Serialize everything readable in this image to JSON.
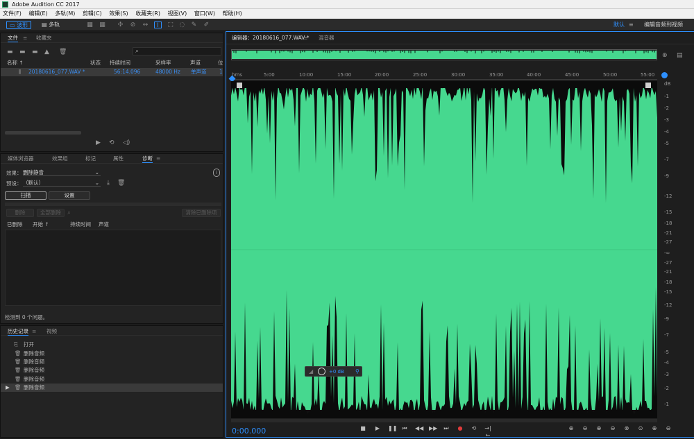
{
  "app": {
    "title": "Adobe Audition CC 2017"
  },
  "menu": [
    "文件(F)",
    "编辑(E)",
    "多轨(M)",
    "剪辑(C)",
    "效果(S)",
    "收藏夹(R)",
    "视图(V)",
    "窗口(W)",
    "帮助(H)"
  ],
  "toolbar": {
    "waveform": "波形",
    "multitrack": "多轨",
    "workspace": "默认",
    "workspace2": "编辑音频到视频"
  },
  "files_panel": {
    "tabs": [
      "文件",
      "收藏夹"
    ],
    "columns": [
      "名称 ↑",
      "状态",
      "持续时间",
      "采样率",
      "声道",
      "位"
    ],
    "file": {
      "name": "20180616_077.WAV *",
      "duration": "56:14.096",
      "rate": "48000 Hz",
      "channels": "单声道",
      "bit": "1"
    }
  },
  "diag_panel": {
    "tabs": [
      "媒体浏览器",
      "效果组",
      "标记",
      "属性",
      "诊断"
    ],
    "effect_label": "效果：",
    "effect_value": "删除静音",
    "preset_label": "预设：",
    "preset_value": "（默认）",
    "scan": "扫描",
    "settings": "设置",
    "delete": "删除",
    "delete_all": "全部删除",
    "clear_deleted": "清除已删除项",
    "cols": [
      "已删除",
      "开始 ↑",
      "持续时间",
      "声道"
    ],
    "status": "检测到 0 个问题。"
  },
  "history_panel": {
    "tabs": [
      "历史记录",
      "视频"
    ],
    "items": [
      "打开",
      "删除音频",
      "删除音频",
      "删除音频",
      "删除音频",
      "删除音频"
    ]
  },
  "editor": {
    "tab": "编辑器：20180616_077.WAV *",
    "tab2": "混音器",
    "ruler": [
      "hms",
      "5:00",
      "10:00",
      "15:00",
      "20:00",
      "25:00",
      "30:00",
      "35:00",
      "40:00",
      "45:00",
      "50:00",
      "55:00"
    ],
    "db_top": [
      "dB",
      "-1",
      "-2",
      "-3",
      "-4",
      "-5",
      "-7",
      "-9",
      "-12",
      "-15",
      "-18",
      "-21",
      "-27",
      "-∞",
      "-27",
      "-21",
      "-18",
      "-15",
      "-12",
      "-9",
      "-7",
      "-5",
      "-4",
      "-3",
      "-2",
      "-1"
    ],
    "gain": "+0 dB",
    "timecode": "0:00.000",
    "wave_color": "#46d88f"
  }
}
